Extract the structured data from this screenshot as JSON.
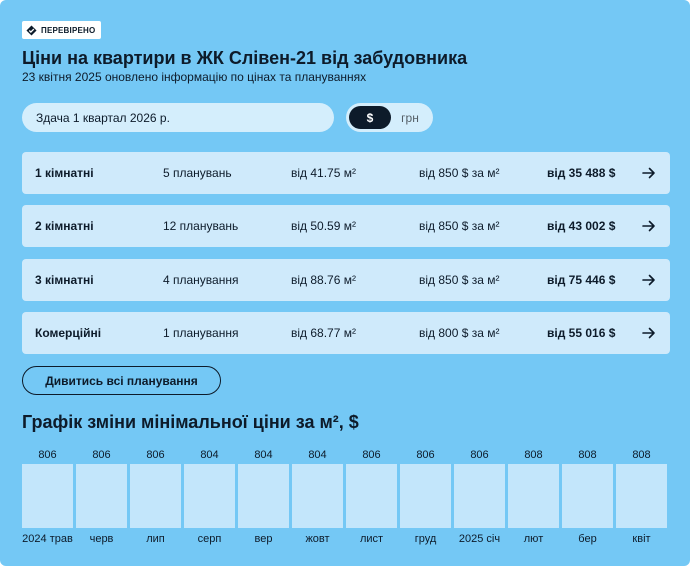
{
  "badge": {
    "label": "ПЕРЕВІРЕНО",
    "icon": "verified-diamond-icon"
  },
  "header": {
    "title": "Ціни на квартири в ЖК Слівен-21 від забудовника",
    "subtitle": "23 квітня 2025 оновлено інформацію по цінах та плануваннях"
  },
  "delivery": {
    "label": "Здача 1 квартал 2026 р."
  },
  "currency": {
    "options": [
      "$",
      "грн"
    ],
    "selected": "$"
  },
  "rows": [
    {
      "name": "1 кімнатні",
      "plans": "5 планувань",
      "area": "від 41.75 м²",
      "price_per_m2": "від 850 $ за м²",
      "price": "від 35 488 $"
    },
    {
      "name": "2 кімнатні",
      "plans": "12 планувань",
      "area": "від 50.59 м²",
      "price_per_m2": "від 850 $ за м²",
      "price": "від 43 002 $"
    },
    {
      "name": "3 кімнатні",
      "plans": "4 планування",
      "area": "від 88.76 м²",
      "price_per_m2": "від 850 $ за м²",
      "price": "від 75 446 $"
    },
    {
      "name": "Комерційні",
      "plans": "1 планування",
      "area": "від 68.77 м²",
      "price_per_m2": "від 800 $ за м²",
      "price": "від 55 016 $"
    }
  ],
  "view_all_label": "Дивитись всі планування",
  "chart_title": "Графік зміни мінімальної ціни за м², $",
  "chart_data": {
    "type": "bar",
    "categories": [
      "2024 трав",
      "черв",
      "лип",
      "серп",
      "вер",
      "жовт",
      "лист",
      "груд",
      "2025 січ",
      "лют",
      "бер",
      "квіт"
    ],
    "values": [
      806,
      806,
      806,
      804,
      804,
      804,
      806,
      806,
      806,
      808,
      808,
      808
    ],
    "title": "",
    "xlabel": "",
    "ylabel": "",
    "bar_color": "#c3e6fb"
  }
}
